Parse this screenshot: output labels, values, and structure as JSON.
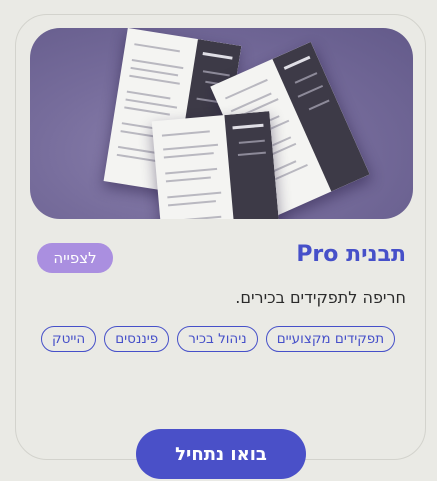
{
  "card": {
    "image": "resume-templates-image",
    "title": "תבנית Pro",
    "preview_label": "לצפייה",
    "description": "חריפה לתפקידים בכירים.",
    "tags": [
      "הייטק",
      "פיננסים",
      "ניהול בכיר",
      "תפקידים מקצועיים"
    ],
    "cta_label": "בואו נתחיל"
  },
  "colors": {
    "accent": "#4650c9",
    "preview": "#aa8fe0",
    "background": "#eaeae5",
    "hero": "#776d9c"
  }
}
